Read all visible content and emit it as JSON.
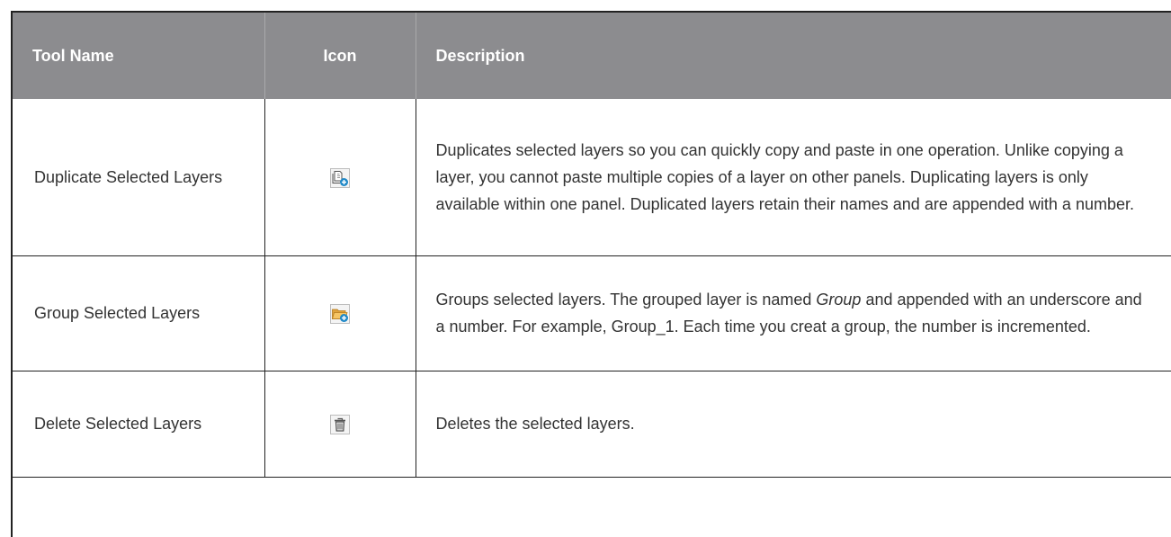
{
  "table": {
    "headers": {
      "tool_name": "Tool Name",
      "icon": "Icon",
      "description": "Description"
    },
    "rows": [
      {
        "tool_name": "Duplicate Selected Layers",
        "icon": "duplicate-layers-icon",
        "description_parts": [
          "Duplicates selected layers so you can quickly copy and paste in one operation. Unlike copying a layer, you cannot paste multiple copies of a layer on other panels. Duplicating layers is only available within one panel. Duplicated layers retain their names and are appended with a number."
        ]
      },
      {
        "tool_name": "Group Selected Layers",
        "icon": "group-layers-icon",
        "description_parts": [
          "Groups selected layers. The grouped layer is named ",
          "Group",
          " and appended with an underscore and a number. For example, Group_1. Each time you creat a group, the number is incremented."
        ]
      },
      {
        "tool_name": "Delete Selected Layers",
        "icon": "trash-icon",
        "description_parts": [
          "Deletes the selected layers."
        ]
      }
    ]
  },
  "colors": {
    "header_bg": "#8c8c8f",
    "header_text": "#ffffff",
    "body_text": "#333333",
    "border": "#222222",
    "icon_accent": "#1e88c7"
  }
}
